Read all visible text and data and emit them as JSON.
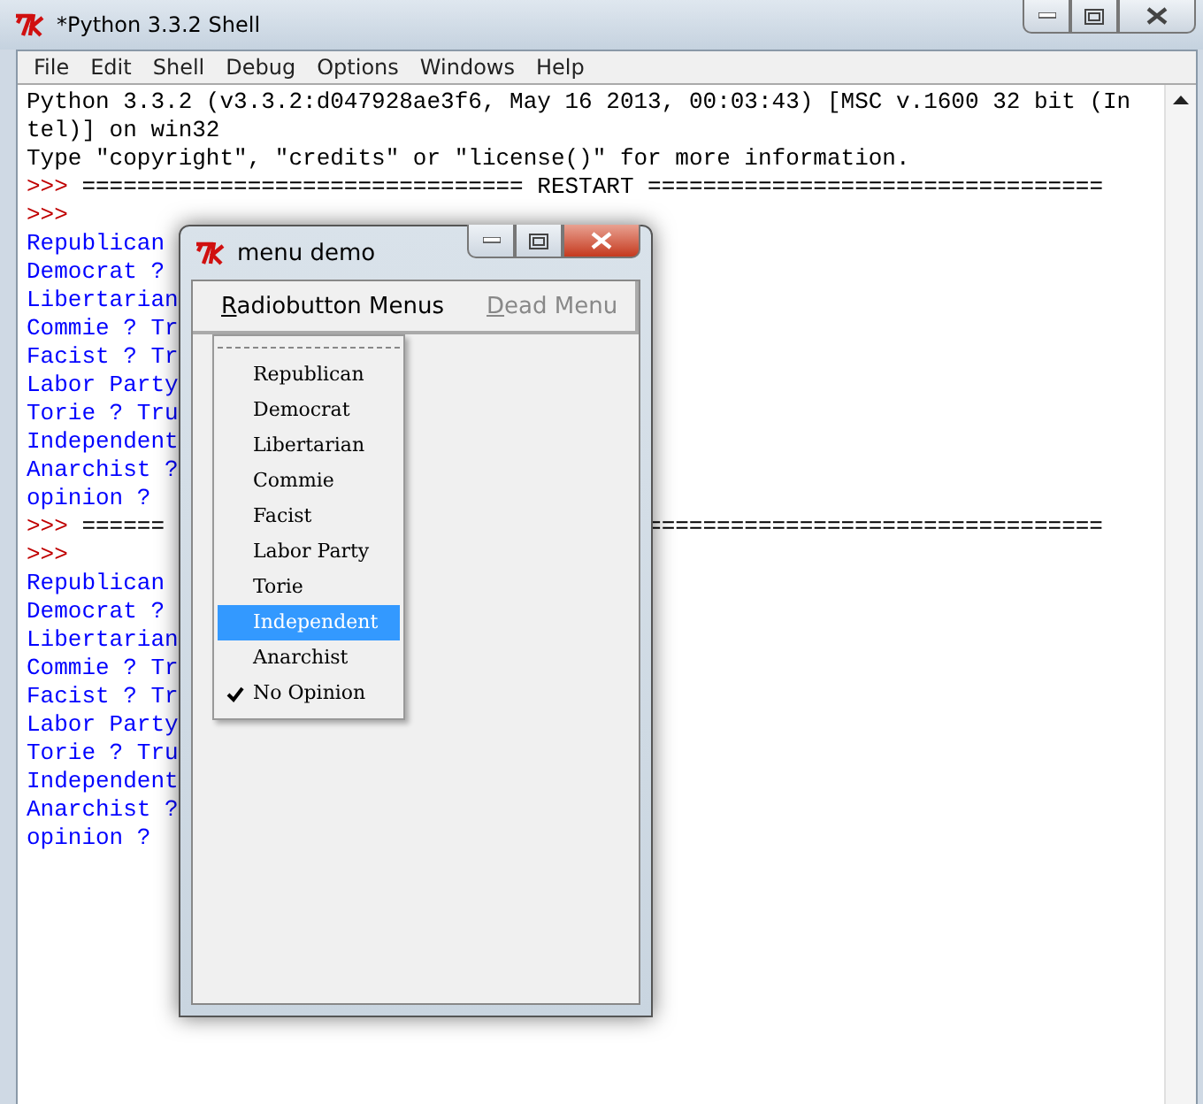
{
  "window": {
    "title": "*Python 3.3.2 Shell"
  },
  "menu_bar": [
    "File",
    "Edit",
    "Shell",
    "Debug",
    "Options",
    "Windows",
    "Help"
  ],
  "shell": {
    "lines": [
      {
        "kind": "info",
        "text": "Python 3.3.2 (v3.3.2:d047928ae3f6, May 16 2013, 00:03:43) [MSC v.1600 32 bit (In"
      },
      {
        "kind": "info",
        "text": "tel)] on win32"
      },
      {
        "kind": "info",
        "text": "Type \"copyright\", \"credits\" or \"license()\" for more information."
      },
      {
        "kind": "restart",
        "prompt": ">>>",
        "text": "================================ RESTART ================================="
      },
      {
        "kind": "prompt",
        "prompt": ">>>"
      },
      {
        "kind": "output",
        "text": "Republican"
      },
      {
        "kind": "output",
        "text": "Democrat ?"
      },
      {
        "kind": "output",
        "text": "Libertarian"
      },
      {
        "kind": "output",
        "text": "Commie ? Tr"
      },
      {
        "kind": "output",
        "text": "Facist ? Tr"
      },
      {
        "kind": "output",
        "text": "Labor Party"
      },
      {
        "kind": "output",
        "text": "Torie ? Tru"
      },
      {
        "kind": "output",
        "text": "Independent"
      },
      {
        "kind": "output",
        "text": "Anarchist ?"
      },
      {
        "kind": "output",
        "text": "opinion ?"
      },
      {
        "kind": "restart",
        "prompt": ">>>",
        "text": "======",
        "text_right": "================================="
      },
      {
        "kind": "prompt",
        "prompt": ">>>"
      },
      {
        "kind": "output",
        "text": "Republican"
      },
      {
        "kind": "output",
        "text": "Democrat ?"
      },
      {
        "kind": "output",
        "text": "Libertarian"
      },
      {
        "kind": "output",
        "text": "Commie ? Tr"
      },
      {
        "kind": "output",
        "text": "Facist ? Tr"
      },
      {
        "kind": "output",
        "text": "Labor Party"
      },
      {
        "kind": "output",
        "text": "Torie ? Tru"
      },
      {
        "kind": "output",
        "text": "Independent"
      },
      {
        "kind": "output",
        "text": "Anarchist ?"
      },
      {
        "kind": "output",
        "text": "opinion ?"
      }
    ]
  },
  "dialog": {
    "title": "menu demo",
    "menus": [
      {
        "label": "Radiobutton Menus",
        "disabled": false
      },
      {
        "label": "Dead Menu",
        "disabled": true
      }
    ],
    "dropdown": {
      "tear_off": true,
      "items": [
        {
          "label": "Republican",
          "selected": false,
          "checked": false
        },
        {
          "label": "Democrat",
          "selected": false,
          "checked": false
        },
        {
          "label": "Libertarian",
          "selected": false,
          "checked": false
        },
        {
          "label": "Commie",
          "selected": false,
          "checked": false
        },
        {
          "label": "Facist",
          "selected": false,
          "checked": false
        },
        {
          "label": "Labor Party",
          "selected": false,
          "checked": false
        },
        {
          "label": "Torie",
          "selected": false,
          "checked": false
        },
        {
          "label": "Independent",
          "selected": true,
          "checked": false
        },
        {
          "label": "Anarchist",
          "selected": false,
          "checked": false
        },
        {
          "label": "No Opinion",
          "selected": false,
          "checked": true
        }
      ]
    }
  }
}
